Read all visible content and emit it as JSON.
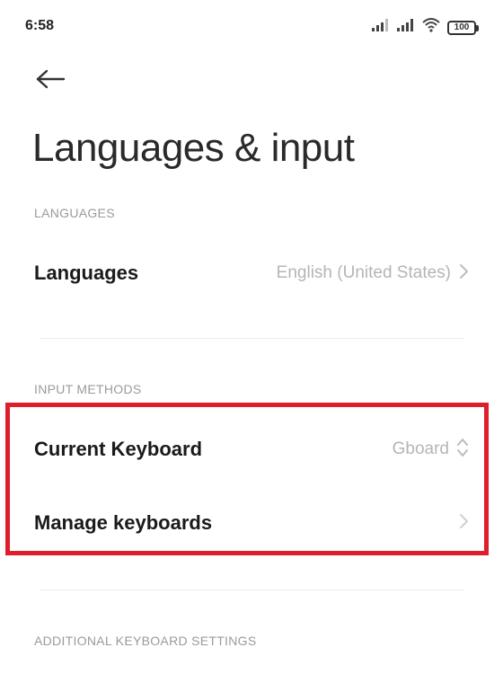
{
  "status_bar": {
    "time": "6:58",
    "battery": "100",
    "icons": [
      "signal-icon",
      "signal-icon",
      "wifi-icon",
      "battery-icon"
    ]
  },
  "header": {
    "back_icon": "arrow-left-icon",
    "title": "Languages & input"
  },
  "sections": {
    "languages": {
      "header": "LANGUAGES",
      "items": [
        {
          "label": "Languages",
          "value": "English (United States)",
          "icon": "chevron-right-icon"
        }
      ]
    },
    "input_methods": {
      "header": "INPUT METHODS",
      "items": [
        {
          "label": "Current Keyboard",
          "value": "Gboard",
          "icon": "chevron-up-down-icon"
        },
        {
          "label": "Manage keyboards",
          "value": "",
          "icon": "chevron-right-icon"
        }
      ]
    },
    "additional": {
      "header": "ADDITIONAL KEYBOARD SETTINGS"
    }
  },
  "colors": {
    "highlight": "#e01e2b",
    "section_header": "#9a9a9a",
    "value_text": "#b5b5b5"
  }
}
